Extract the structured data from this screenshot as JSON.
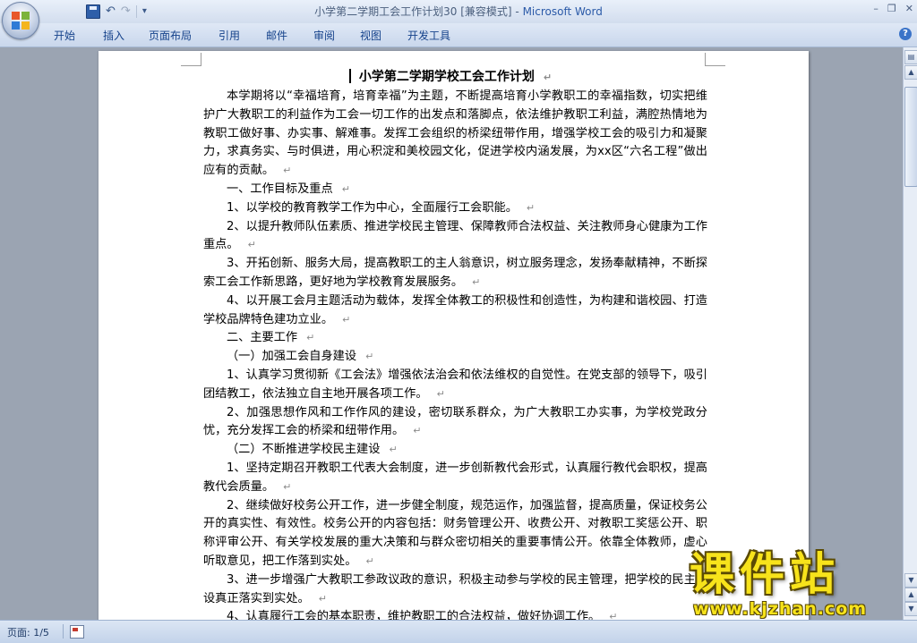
{
  "window": {
    "title": "小学第二学期工会工作计划30 [兼容模式]",
    "title_sep": " - ",
    "app_name": "Microsoft Word",
    "minimize_glyph": "–",
    "restore_glyph": "❐",
    "close_glyph": "✕"
  },
  "quick_access": {
    "undo_glyph": "↶",
    "redo_glyph": "↷",
    "customize_glyph": "▾"
  },
  "ribbon": {
    "tabs": [
      "开始",
      "插入",
      "页面布局",
      "引用",
      "邮件",
      "审阅",
      "视图",
      "开发工具"
    ],
    "help_glyph": "?"
  },
  "document": {
    "paragraph_mark": "↵",
    "title": "小学第二学期学校工会工作计划",
    "paragraphs": [
      "本学期将以“幸福培育，培育幸福”为主题，不断提高培育小学教职工的幸福指数，切实把维护广大教职工的利益作为工会一切工作的出发点和落脚点，依法维护教职工利益，满腔热情地为教职工做好事、办实事、解难事。发挥工会组织的桥梁纽带作用，增强学校工会的吸引力和凝聚力，求真务实、与时俱进，用心积淀和美校园文化，促进学校内涵发展，为xx区“六名工程”做出应有的贡献。",
      "一、工作目标及重点",
      "1、以学校的教育教学工作为中心，全面履行工会职能。",
      "2、以提升教师队伍素质、推进学校民主管理、保障教师合法权益、关注教师身心健康为工作重点。",
      "3、开拓创新、服务大局，提高教职工的主人翁意识，树立服务理念，发扬奉献精神，不断探索工会工作新思路，更好地为学校教育发展服务。",
      "4、以开展工会月主题活动为载体，发挥全体教工的积极性和创造性，为构建和谐校园、打造学校品牌特色建功立业。",
      "二、主要工作",
      "（一）加强工会自身建设",
      "1、认真学习贯彻新《工会法》增强依法治会和依法维权的自觉性。在党支部的领导下，吸引团结教工，依法独立自主地开展各项工作。",
      "2、加强思想作风和工作作风的建设，密切联系群众，为广大教职工办实事，为学校党政分忧，充分发挥工会的桥梁和纽带作用。",
      "（二）不断推进学校民主建设",
      "1、坚持定期召开教职工代表大会制度，进一步创新教代会形式，认真履行教代会职权，提高教代会质量。",
      "2、继续做好校务公开工作，进一步健全制度，规范运作，加强监督，提高质量，保证校务公开的真实性、有效性。校务公开的内容包括：财务管理公开、收费公开、对教职工奖惩公开、职称评审公开、有关学校发展的重大决策和与群众密切相关的重要事情公开。依靠全体教师，虚心听取意见，把工作落到实处。",
      "3、进一步增强广大教职工参政议政的意识，积极主动参与学校的民主管理，把学校的民主建设真正落实到实处。",
      "4、认真履行工会的基本职责，维护教职工的合法权益，做好协调工作。"
    ]
  },
  "scrollbar": {
    "up_glyph": "▲",
    "down_glyph": "▼",
    "prev_glyph": "▲",
    "next_glyph": "▼"
  },
  "status_bar": {
    "page_label": "页面: 1/5"
  },
  "watermark": {
    "title": "课件站",
    "url": "www.kjzhan.com"
  }
}
